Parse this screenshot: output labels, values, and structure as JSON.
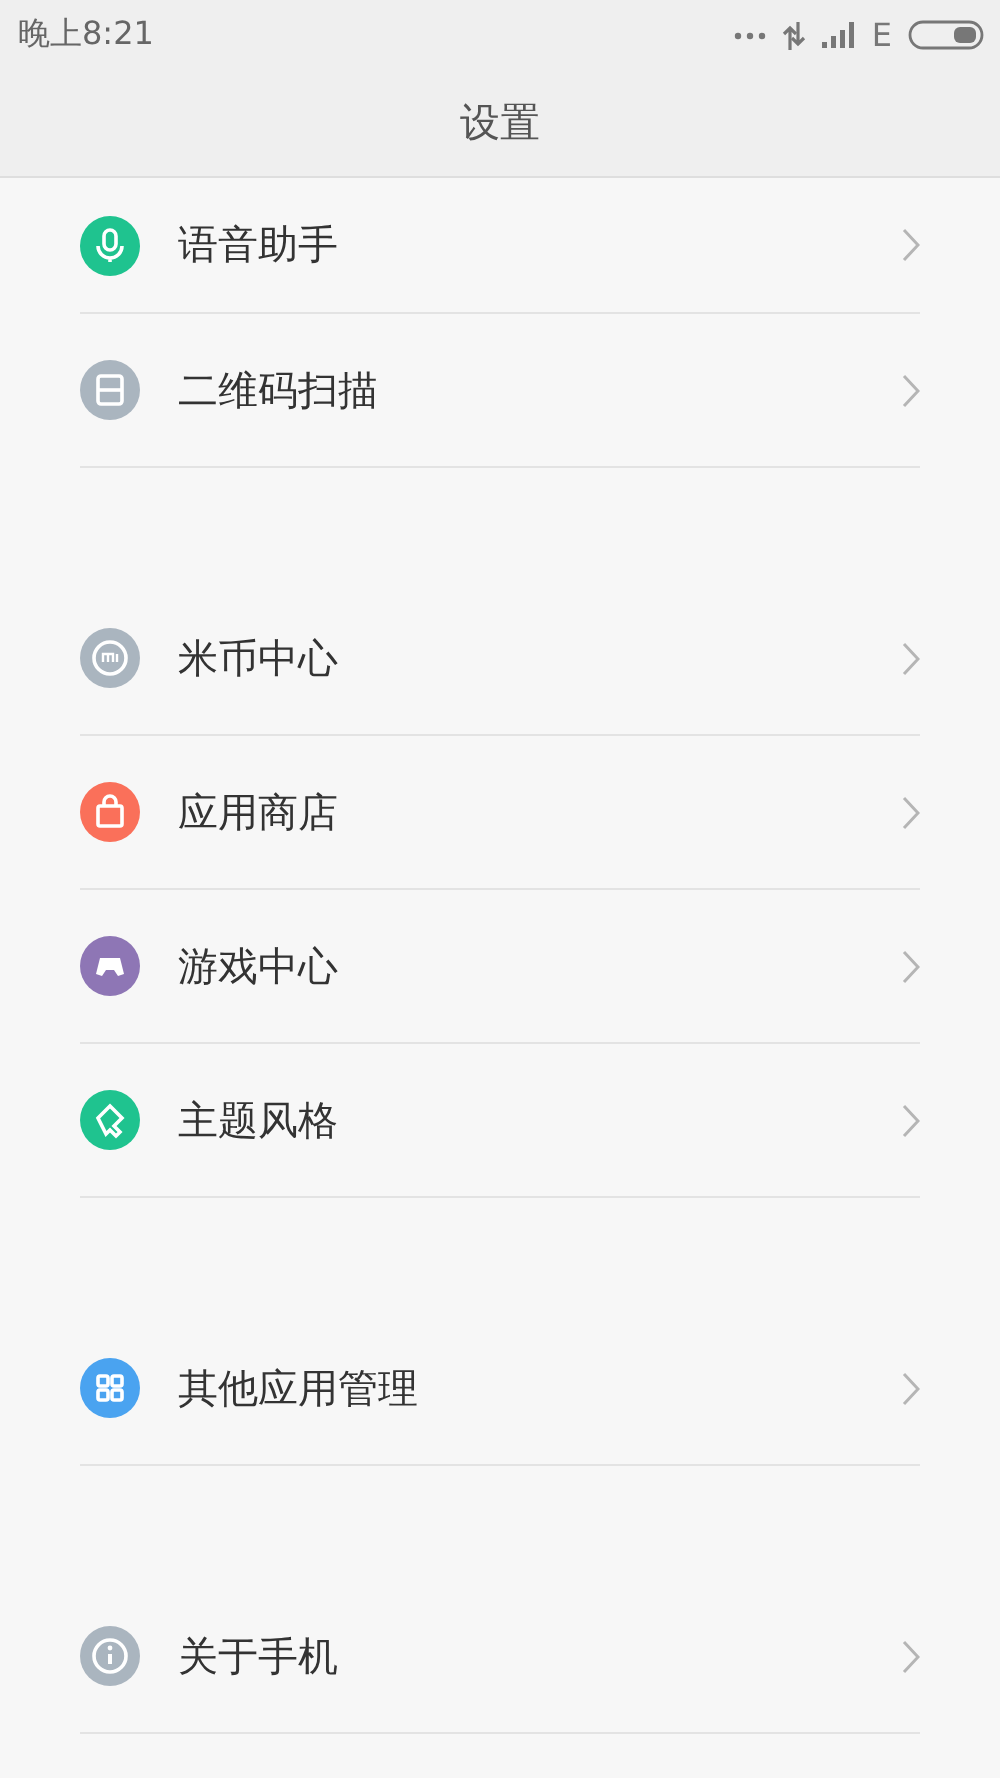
{
  "status_bar": {
    "time": "晚上8:21",
    "network": "E"
  },
  "header": {
    "title": "设置"
  },
  "groups": [
    {
      "items": [
        {
          "label": "语音助手",
          "color": "#1fc38f"
        },
        {
          "label": "二维码扫描",
          "color": "#aab5bf"
        }
      ]
    },
    {
      "items": [
        {
          "label": "米币中心",
          "color": "#aab5bf"
        },
        {
          "label": "应用商店",
          "color": "#fa705a"
        },
        {
          "label": "游戏中心",
          "color": "#8e76b5"
        },
        {
          "label": "主题风格",
          "color": "#1fc38f"
        }
      ]
    },
    {
      "items": [
        {
          "label": "其他应用管理",
          "color": "#4aa3f0"
        }
      ]
    },
    {
      "items": [
        {
          "label": "关于手机",
          "color": "#aab5bf"
        }
      ]
    }
  ]
}
